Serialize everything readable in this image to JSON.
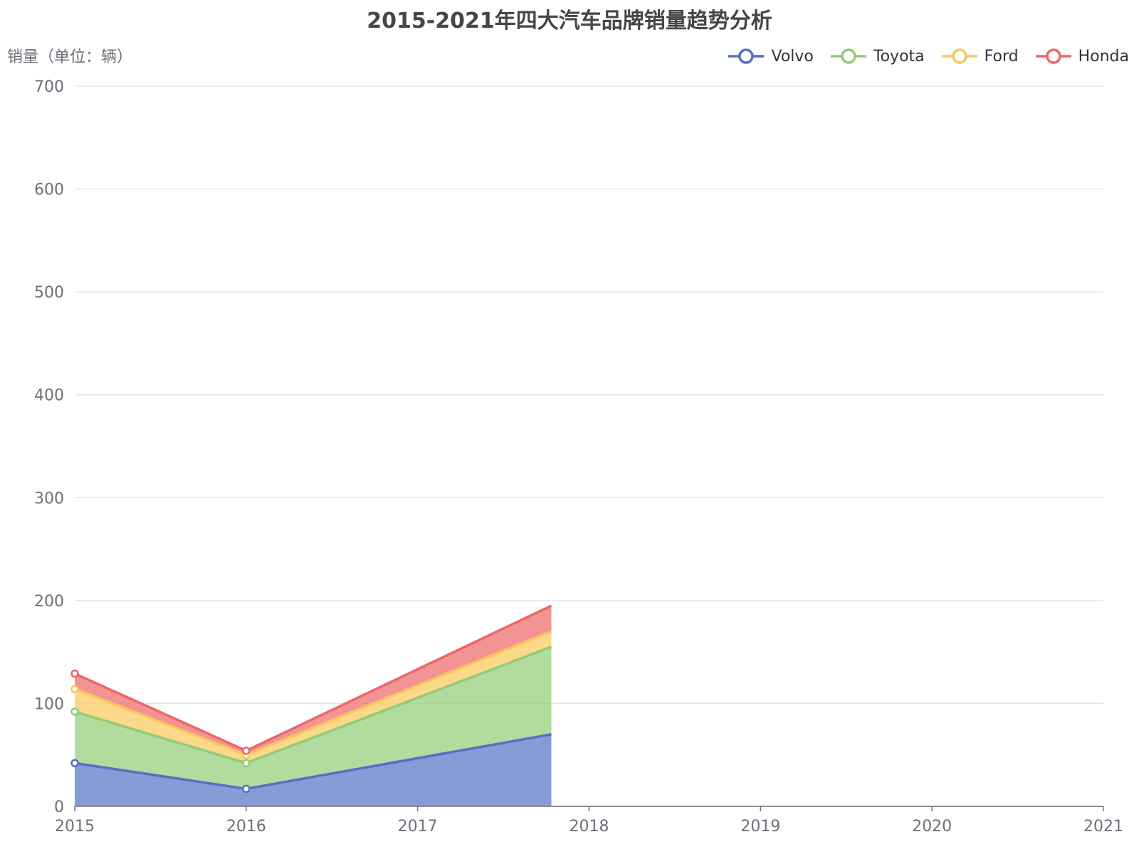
{
  "chart_data": {
    "type": "area",
    "stacked": true,
    "title": "2015-2021年四大汽车品牌销量趋势分析",
    "ylabel": "销量（单位：辆）",
    "xlabel": "",
    "x": [
      "2015",
      "2016",
      "2017",
      "2018",
      "2019",
      "2020",
      "2021"
    ],
    "ylim": [
      0,
      700
    ],
    "yticks": [
      "0",
      "100",
      "200",
      "300",
      "400",
      "500",
      "600",
      "700"
    ],
    "grid": true,
    "legend_position": "top-right",
    "x_visible_extent": 2.78,
    "series": [
      {
        "name": "Volvo",
        "color": "#5470c6",
        "values": [
          42,
          17,
          70
        ]
      },
      {
        "name": "Toyota",
        "color": "#91cc75",
        "values": [
          50,
          25,
          85
        ]
      },
      {
        "name": "Ford",
        "color": "#fac858",
        "values": [
          22,
          8,
          15
        ]
      },
      {
        "name": "Honda",
        "color": "#ee6666",
        "values": [
          15,
          4,
          25
        ]
      }
    ]
  }
}
